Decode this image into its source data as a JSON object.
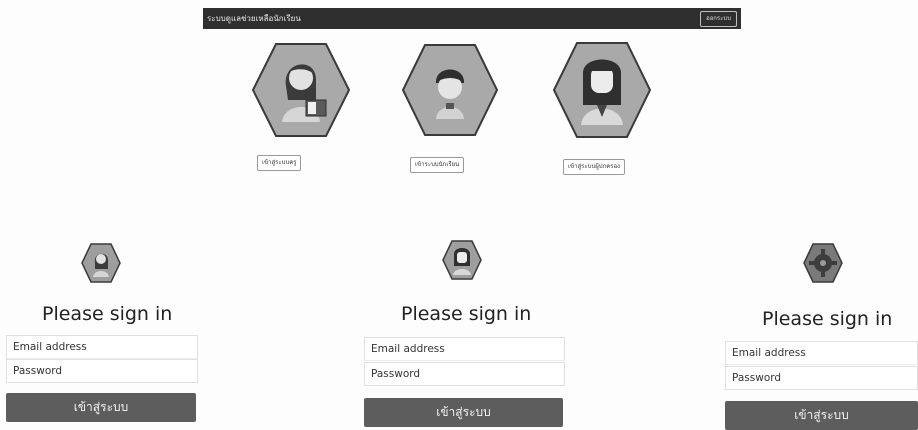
{
  "navbar": {
    "brand": "ระบบดูแลช่วยเหลือนักเรียน",
    "logout_label": "ออกระบบ"
  },
  "roles": [
    {
      "name": "teacher",
      "button_label": "เข้าสู่ระบบครู"
    },
    {
      "name": "student",
      "button_label": "เข้าระบบนักเรียน"
    },
    {
      "name": "parent",
      "button_label": "เข้าสู่ระบบผู้ปกครอง"
    }
  ],
  "signin_panels": [
    {
      "logo": "teacher-avatar-icon",
      "title": "Please sign in",
      "email_placeholder": "Email address",
      "password_placeholder": "Password",
      "submit_label": "เข้าสู่ระบบ"
    },
    {
      "logo": "student-avatar-icon",
      "title": "Please sign in",
      "email_placeholder": "Email address",
      "password_placeholder": "Password",
      "submit_label": "เข้าสู่ระบบ"
    },
    {
      "logo": "gear-icon",
      "title": "Please sign in",
      "email_placeholder": "Email address",
      "password_placeholder": "Password",
      "submit_label": "เข้าสู่ระบบ"
    }
  ],
  "colors": {
    "navbar_bg": "#2f2f2f",
    "button_bg": "#5d5d5d",
    "hexagon_fill": "#a9a9a9",
    "hexagon_stroke": "#3a3a3a"
  }
}
